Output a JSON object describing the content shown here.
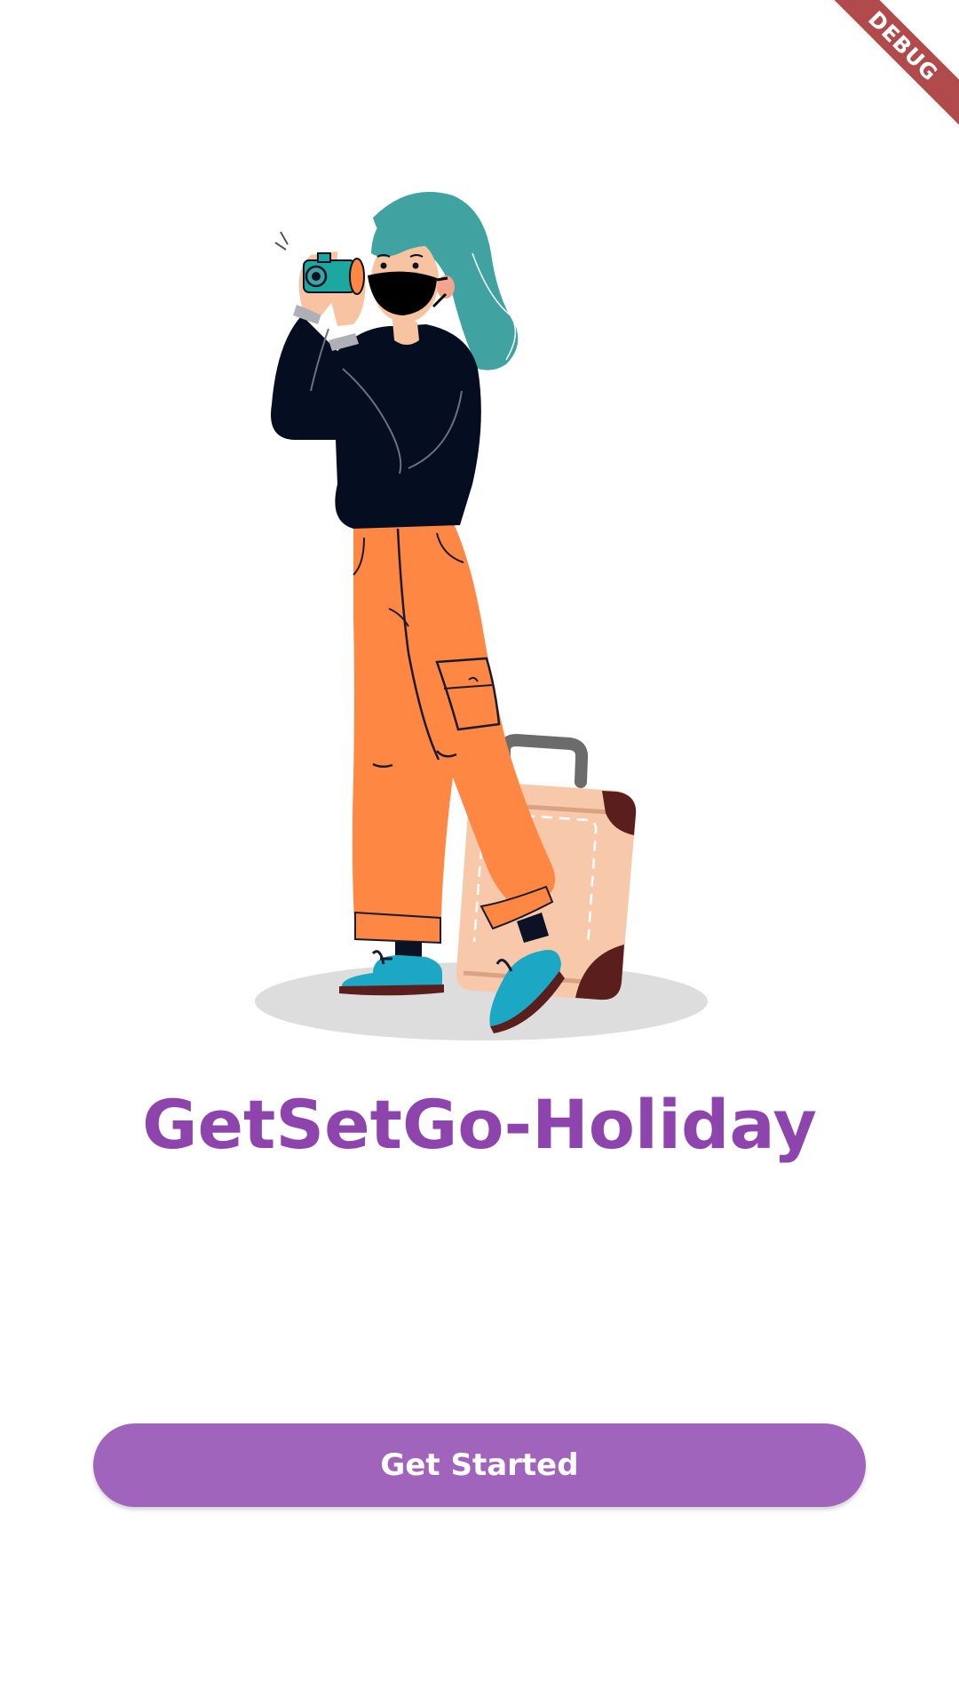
{
  "app": {
    "title": "GetSetGo-Holiday",
    "accent_color": "#8E44AD",
    "button_color": "#A064BC"
  },
  "illustration": {
    "description_icon": "traveler-with-camera-and-suitcase-illustration"
  },
  "actions": {
    "get_started_label": "Get Started"
  },
  "debug_banner": {
    "label": "DEBUG",
    "color": "#B14A4A"
  }
}
